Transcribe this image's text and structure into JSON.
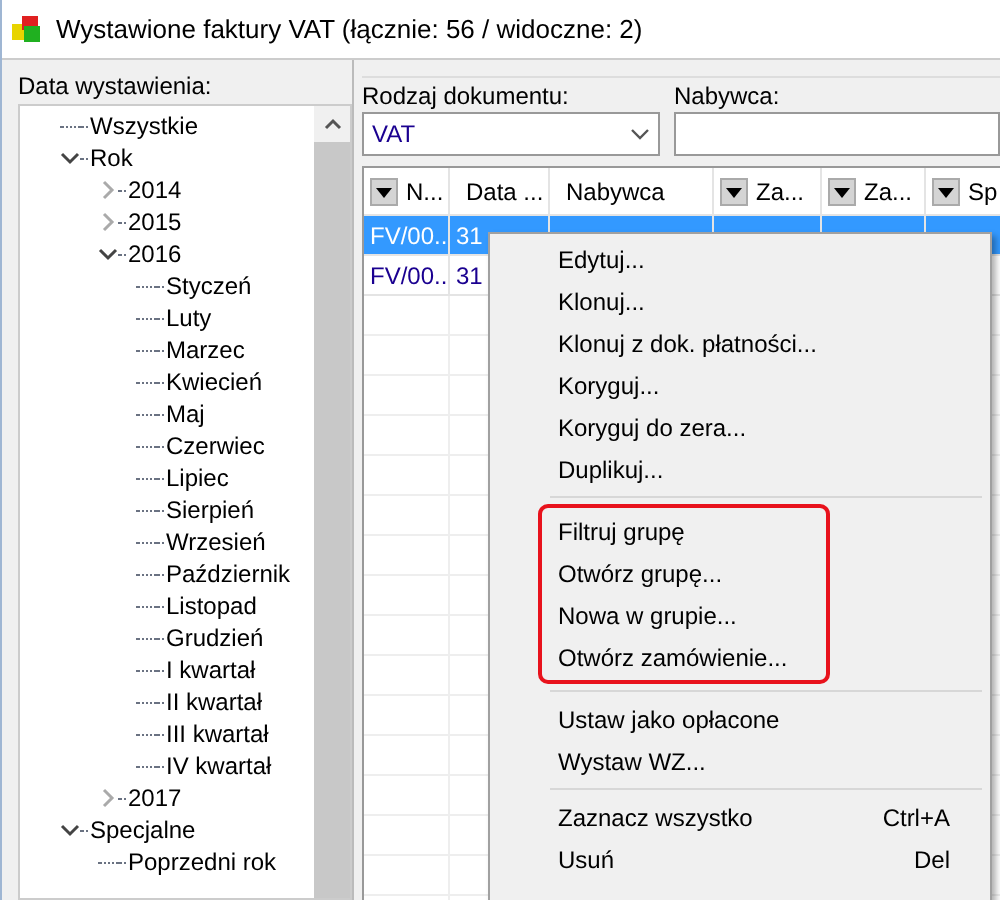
{
  "window": {
    "title": "Wystawione faktury VAT (łącznie: 56 / widoczne: 2)"
  },
  "date_filter": {
    "label": "Data wystawienia:",
    "tree": [
      {
        "label": "Wszystkie"
      },
      {
        "label": "Rok",
        "expanded": true,
        "children": [
          {
            "label": "2014",
            "expanded": false
          },
          {
            "label": "2015",
            "expanded": false
          },
          {
            "label": "2016",
            "expanded": true,
            "children": [
              {
                "label": "Styczeń"
              },
              {
                "label": "Luty"
              },
              {
                "label": "Marzec"
              },
              {
                "label": "Kwiecień"
              },
              {
                "label": "Maj"
              },
              {
                "label": "Czerwiec"
              },
              {
                "label": "Lipiec"
              },
              {
                "label": "Sierpień"
              },
              {
                "label": "Wrzesień"
              },
              {
                "label": "Październik"
              },
              {
                "label": "Listopad"
              },
              {
                "label": "Grudzień"
              },
              {
                "label": "I kwartał"
              },
              {
                "label": "II kwartał"
              },
              {
                "label": "III kwartał"
              },
              {
                "label": "IV kwartał"
              }
            ]
          },
          {
            "label": "2017",
            "expanded": false
          }
        ]
      },
      {
        "label": "Specjalne",
        "expanded": true,
        "children": [
          {
            "label": "Poprzedni rok"
          }
        ]
      }
    ]
  },
  "document_type": {
    "label": "Rodzaj dokumentu:",
    "value": "VAT"
  },
  "buyer": {
    "label": "Nabywca:"
  },
  "table": {
    "columns": [
      {
        "label": "N...",
        "filter": true
      },
      {
        "label": "Data ...",
        "filter": false
      },
      {
        "label": "Nabywca",
        "filter": false
      },
      {
        "label": "Za...",
        "filter": true
      },
      {
        "label": "Za...",
        "filter": true
      },
      {
        "label": "Sp",
        "filter": true
      }
    ],
    "rows": [
      {
        "selected": true,
        "cells": [
          "FV/00...",
          "31"
        ]
      },
      {
        "selected": false,
        "cells": [
          "FV/00...",
          "31"
        ]
      }
    ]
  },
  "context_menu": {
    "groups": [
      {
        "highlighted": false,
        "items": [
          {
            "label": "Edytuj..."
          },
          {
            "label": "Klonuj..."
          },
          {
            "label": "Klonuj z dok. płatności..."
          },
          {
            "label": "Koryguj..."
          },
          {
            "label": "Koryguj do zera..."
          },
          {
            "label": "Duplikuj..."
          }
        ]
      },
      {
        "highlighted": true,
        "items": [
          {
            "label": "Filtruj grupę"
          },
          {
            "label": "Otwórz grupę..."
          },
          {
            "label": "Nowa w grupie..."
          },
          {
            "label": "Otwórz zamówienie..."
          }
        ]
      },
      {
        "highlighted": false,
        "items": [
          {
            "label": "Ustaw jako opłacone"
          },
          {
            "label": "Wystaw WZ..."
          }
        ]
      },
      {
        "highlighted": false,
        "items": [
          {
            "label": "Zaznacz wszystko",
            "shortcut": "Ctrl+A"
          },
          {
            "label": "Usuń",
            "shortcut": "Del"
          }
        ]
      }
    ]
  }
}
